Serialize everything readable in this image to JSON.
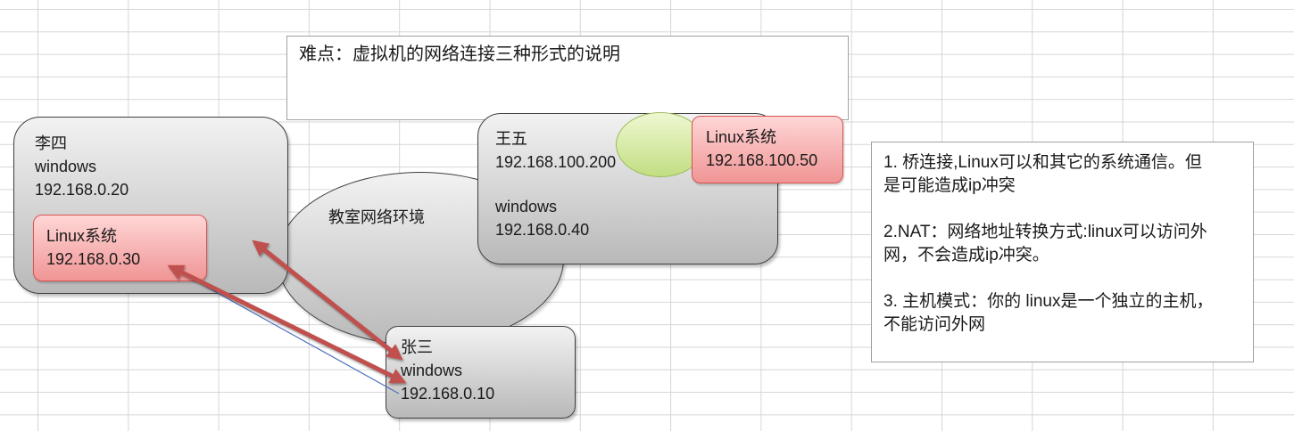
{
  "title_note": {
    "text": "难点：虚拟机的网络连接三种形式的说明"
  },
  "network": {
    "label": "教室网络环境"
  },
  "hosts": {
    "lisi": {
      "name": "李四",
      "os": "windows",
      "ip": "192.168.0.20",
      "vm": {
        "label": "Linux系统",
        "ip": "192.168.0.30"
      }
    },
    "wangwu": {
      "name": "王五",
      "ip_upper": "192.168.100.200",
      "os": "windows",
      "ip": "192.168.0.40",
      "vm": {
        "label": "Linux系统",
        "ip": "192.168.100.50"
      }
    },
    "zhangsan": {
      "name": "张三",
      "os": "windows",
      "ip": "192.168.0.10"
    }
  },
  "notes": [
    {
      "lines": [
        "1. 桥连接,Linux可以和其它的系统通信。但",
        "是可能造成ip冲突"
      ]
    },
    {
      "lines": [
        "2.NAT：网络地址转换方式:linux可以访问外",
        "网，不会造成ip冲突。"
      ]
    },
    {
      "lines": [
        "3. 主机模式：你的 linux是一个独立的主机，",
        "不能访问外网"
      ]
    }
  ],
  "colors": {
    "arrow": "#c0504d",
    "connector": "#4f6fbf",
    "grid": "#d6d6d6",
    "note_border": "#a0a0a0",
    "host_fill_top": "#f2f2f2",
    "host_fill_bottom": "#b9b9b9",
    "host_border": "#3f3f3f",
    "vm_fill_top": "#ffd6d6",
    "vm_fill_bottom": "#f09595",
    "vm_border": "#d9534f",
    "green_fill_top": "#eef8d2",
    "green_fill_bottom": "#c2de82",
    "green_border": "#9bbb59"
  }
}
